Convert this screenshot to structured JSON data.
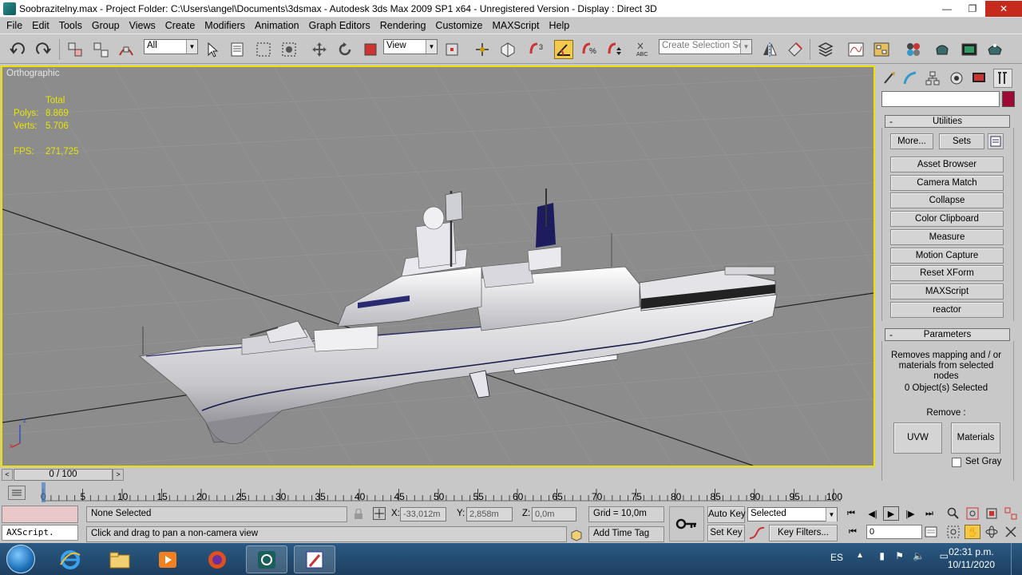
{
  "window": {
    "title": "Soobrazitelny.max    - Project Folder: C:\\Users\\angel\\Documents\\3dsmax    - Autodesk 3ds Max  2009 SP1  x64   - Unregistered Version     - Display : Direct 3D",
    "minimize": "—",
    "restore": "❐",
    "close": "✕"
  },
  "menu": [
    "File",
    "Edit",
    "Tools",
    "Group",
    "Views",
    "Create",
    "Modifiers",
    "Animation",
    "Graph Editors",
    "Rendering",
    "Customize",
    "MAXScript",
    "Help"
  ],
  "toolbar": {
    "selection_filter": "All",
    "reference_coord": "View",
    "selection_set_placeholder": "Create Selection Set"
  },
  "viewport": {
    "label": "Orthographic",
    "stats_header": "Total",
    "polys_label": "Polys:",
    "polys_value": "8.869",
    "verts_label": "Verts:",
    "verts_value": "5.706",
    "fps_label": "FPS:",
    "fps_value": "271,725",
    "axis_x": "x",
    "axis_z": "z"
  },
  "command_panel": {
    "object_name": "",
    "object_color": "#9c0a35",
    "utilities_title": "Utilities",
    "more_label": "More...",
    "sets_label": "Sets",
    "utility_buttons": [
      "Asset Browser",
      "Camera Match",
      "Collapse",
      "Color Clipboard",
      "Measure",
      "Motion Capture",
      "Reset XForm",
      "MAXScript",
      "reactor"
    ],
    "parameters_title": "Parameters",
    "description": "Removes mapping and / or materials from selected nodes",
    "selected_count": "0 Object(s) Selected",
    "remove_label": "Remove :",
    "uvw_label": "UVW",
    "materials_label": "Materials",
    "set_gray_label": "Set Gray"
  },
  "timeline": {
    "frame_display": "0 / 100",
    "ticks": [
      "0",
      "5",
      "10",
      "15",
      "20",
      "25",
      "30",
      "35",
      "40",
      "45",
      "50",
      "55",
      "60",
      "65",
      "70",
      "75",
      "80",
      "85",
      "90",
      "95",
      "100"
    ]
  },
  "status": {
    "maxscript_listener": "",
    "maxscript_prompt": "AXScript.",
    "selection_status": "None Selected",
    "prompt": "Click and drag to pan a non-camera view",
    "x_label": "X:",
    "x_value": "-33,012m",
    "y_label": "Y:",
    "y_value": "2,858m",
    "z_label": "Z:",
    "z_value": "0,0m",
    "grid": "Grid = 10,0m",
    "add_time_tag": "Add Time Tag",
    "auto_key": "Auto Key",
    "set_key": "Set Key",
    "key_mode": "Selected",
    "key_filters": "Key Filters...",
    "current_frame": "0"
  },
  "taskbar": {
    "language": "ES",
    "time": "02:31 p.m.",
    "date": "10/11/2020"
  }
}
